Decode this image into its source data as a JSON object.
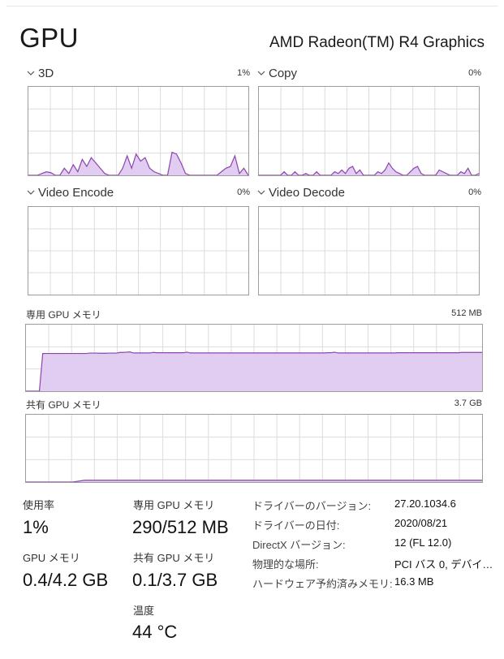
{
  "header": {
    "title": "GPU",
    "device": "AMD Radeon(TM) R4 Graphics"
  },
  "colors": {
    "accent_line": "#8e44ad",
    "accent_fill": "#e2cdf2",
    "grid": "#dcdcdc",
    "border": "#9c9c9c"
  },
  "engines": [
    {
      "name": "3D",
      "pct": "1%",
      "samples": [
        0,
        0,
        0,
        2,
        4,
        3,
        0,
        0,
        8,
        2,
        12,
        4,
        18,
        10,
        20,
        14,
        8,
        2,
        0,
        0,
        0,
        8,
        22,
        8,
        24,
        16,
        20,
        8,
        4,
        2,
        0,
        0,
        26,
        24,
        14,
        2,
        0,
        0,
        0,
        0,
        0,
        0,
        0,
        4,
        8,
        10,
        22,
        2,
        8,
        0
      ]
    },
    {
      "name": "Copy",
      "pct": "0%",
      "samples": [
        0,
        0,
        0,
        0,
        0,
        0,
        0,
        4,
        0,
        0,
        4,
        0,
        0,
        2,
        0,
        0,
        4,
        0,
        0,
        0,
        0,
        4,
        2,
        6,
        2,
        8,
        10,
        2,
        6,
        0,
        0,
        0,
        0,
        4,
        2,
        6,
        14,
        8,
        4,
        2,
        0,
        0,
        4,
        8,
        10,
        2,
        0,
        0,
        0,
        0,
        6,
        4,
        2,
        0,
        0,
        0,
        4,
        2,
        8,
        0,
        0,
        2
      ]
    },
    {
      "name": "Video Encode",
      "pct": "0%",
      "samples": []
    },
    {
      "name": "Video Decode",
      "pct": "0%",
      "samples": []
    }
  ],
  "dedicated_graph": {
    "label": "専用 GPU メモリ",
    "capacity": "512 MB",
    "samples": [
      0,
      0,
      0,
      0,
      0,
      290,
      290,
      290,
      290,
      290,
      290,
      290,
      290,
      290,
      290,
      290,
      290,
      290,
      290,
      293,
      293,
      293,
      292,
      292,
      292,
      293,
      293,
      293,
      298,
      298,
      300,
      302,
      294,
      294,
      294,
      294,
      294,
      294,
      298,
      296,
      296,
      296,
      296,
      296,
      296,
      296,
      296,
      296,
      300,
      294,
      294,
      294,
      294,
      294,
      294,
      294,
      294,
      294,
      294,
      294,
      294,
      294,
      294,
      294,
      294,
      294,
      294,
      294,
      294,
      294,
      294,
      294,
      294,
      294,
      294,
      294,
      294,
      294,
      294,
      294,
      294,
      294,
      294,
      294,
      294,
      294,
      294,
      294,
      294,
      294,
      296,
      296,
      300,
      294,
      294,
      294,
      294,
      294,
      294,
      294,
      294,
      294,
      294,
      294,
      294,
      294,
      294,
      294,
      294,
      294,
      294,
      296,
      296,
      296,
      296,
      296,
      296,
      296,
      296,
      296,
      296,
      296,
      296,
      296,
      296,
      296,
      296,
      296,
      296,
      296,
      298,
      298,
      298,
      298,
      298,
      298,
      298
    ]
  },
  "shared_graph": {
    "label": "共有 GPU メモリ",
    "capacity": "3.7 GB",
    "samples": [
      0,
      0,
      0,
      0,
      0,
      0.1,
      0.1,
      0.1,
      0.1,
      0.1,
      0.1,
      0.1,
      0.1,
      0.1,
      0.1,
      0.1,
      0.1,
      0.1,
      0.1,
      0.1,
      0.1,
      0.1,
      0.1,
      0.1,
      0.1,
      0.1,
      0.1,
      0.1,
      0.1,
      0.1,
      0.1,
      0.1,
      0.1,
      0.1,
      0.1,
      0.1,
      0.1,
      0.1,
      0.1,
      0.1
    ]
  },
  "stats": {
    "utilization": {
      "label": "使用率",
      "value": "1%"
    },
    "dedicated": {
      "label": "専用 GPU メモリ",
      "value": "290/512 MB"
    },
    "gpu_memory": {
      "label": "GPU メモリ",
      "value": "0.4/4.2 GB"
    },
    "shared": {
      "label": "共有 GPU メモリ",
      "value": "0.1/3.7 GB"
    },
    "temperature": {
      "label": "温度",
      "value": "44 °C"
    }
  },
  "info": [
    {
      "key": "ドライバーのバージョン:",
      "value": "27.20.1034.6"
    },
    {
      "key": "ドライバーの日付:",
      "value": "2020/08/21"
    },
    {
      "key": "DirectX バージョン:",
      "value": "12 (FL 12.0)"
    },
    {
      "key": "物理的な場所:",
      "value": "PCI バス 0, デバイ…"
    },
    {
      "key": "ハードウェア予約済みメモリ:",
      "value": "16.3 MB"
    }
  ]
}
